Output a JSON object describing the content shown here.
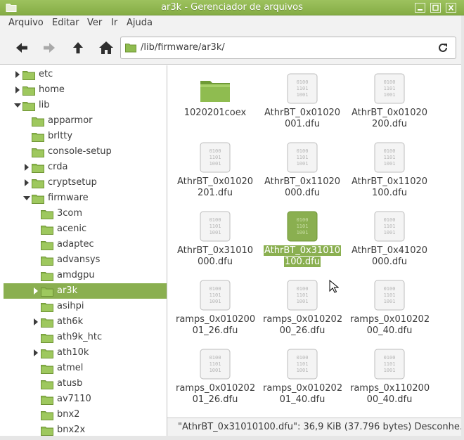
{
  "window": {
    "title": "ar3k - Gerenciador de arquivos",
    "accent": "#8aaf50",
    "folder_color": "#8fbc50"
  },
  "menu": [
    "Arquivo",
    "Editar",
    "Ver",
    "Ir",
    "Ajuda"
  ],
  "toolbar": {
    "back_icon": "arrow-left-icon",
    "forward_icon": "arrow-right-icon",
    "up_icon": "arrow-up-icon",
    "home_icon": "home-icon",
    "location": "/lib/firmware/ar3k/",
    "reload_icon": "reload-icon"
  },
  "sidebar": {
    "items": [
      {
        "label": "etc",
        "expander": "collapsed",
        "level": 0
      },
      {
        "label": "home",
        "expander": "collapsed",
        "level": 0
      },
      {
        "label": "lib",
        "expander": "expanded",
        "level": 0
      },
      {
        "label": "apparmor",
        "expander": "none",
        "level": 1
      },
      {
        "label": "brltty",
        "expander": "none",
        "level": 1
      },
      {
        "label": "console-setup",
        "expander": "none",
        "level": 1
      },
      {
        "label": "crda",
        "expander": "collapsed",
        "level": 1
      },
      {
        "label": "cryptsetup",
        "expander": "collapsed",
        "level": 1
      },
      {
        "label": "firmware",
        "expander": "expanded",
        "level": 1
      },
      {
        "label": "3com",
        "expander": "none",
        "level": 2
      },
      {
        "label": "acenic",
        "expander": "none",
        "level": 2
      },
      {
        "label": "adaptec",
        "expander": "none",
        "level": 2
      },
      {
        "label": "advansys",
        "expander": "none",
        "level": 2
      },
      {
        "label": "amdgpu",
        "expander": "none",
        "level": 2
      },
      {
        "label": "ar3k",
        "expander": "collapsed",
        "level": 2,
        "selected": true
      },
      {
        "label": "asihpi",
        "expander": "none",
        "level": 2
      },
      {
        "label": "ath6k",
        "expander": "collapsed",
        "level": 2
      },
      {
        "label": "ath9k_htc",
        "expander": "none",
        "level": 2
      },
      {
        "label": "ath10k",
        "expander": "collapsed",
        "level": 2
      },
      {
        "label": "atmel",
        "expander": "none",
        "level": 2
      },
      {
        "label": "atusb",
        "expander": "none",
        "level": 2
      },
      {
        "label": "av7110",
        "expander": "none",
        "level": 2
      },
      {
        "label": "bnx2",
        "expander": "none",
        "level": 2
      },
      {
        "label": "bnx2x",
        "expander": "none",
        "level": 2
      }
    ]
  },
  "files": [
    {
      "line1": "1020201coex",
      "line2": "",
      "type": "folder"
    },
    {
      "line1": "AthrBT_0x01020",
      "line2": "001.dfu",
      "type": "binary"
    },
    {
      "line1": "AthrBT_0x01020",
      "line2": "200.dfu",
      "type": "binary"
    },
    {
      "line1": "AthrBT_0x01020",
      "line2": "201.dfu",
      "type": "binary"
    },
    {
      "line1": "AthrBT_0x11020",
      "line2": "000.dfu",
      "type": "binary"
    },
    {
      "line1": "AthrBT_0x11020",
      "line2": "100.dfu",
      "type": "binary"
    },
    {
      "line1": "AthrBT_0x31010",
      "line2": "000.dfu",
      "type": "binary"
    },
    {
      "line1": "AthrBT_0x31010",
      "line2": "100.dfu",
      "type": "binary",
      "selected": true
    },
    {
      "line1": "AthrBT_0x41020",
      "line2": "000.dfu",
      "type": "binary"
    },
    {
      "line1": "ramps_0x010200",
      "line2": "01_26.dfu",
      "type": "binary"
    },
    {
      "line1": "ramps_0x010202",
      "line2": "00_26.dfu",
      "type": "binary"
    },
    {
      "line1": "ramps_0x010202",
      "line2": "00_40.dfu",
      "type": "binary"
    },
    {
      "line1": "ramps_0x010202",
      "line2": "01_26.dfu",
      "type": "binary"
    },
    {
      "line1": "ramps_0x010202",
      "line2": "01_40.dfu",
      "type": "binary"
    },
    {
      "line1": "ramps_0x110200",
      "line2": "00_40.dfu",
      "type": "binary"
    }
  ],
  "binary_icon_text": [
    "0100",
    "1101",
    "1001"
  ],
  "status": "\"AthrBT_0x31010100.dfu\": 36,9 KiB (37.796 bytes) Desconhe…"
}
